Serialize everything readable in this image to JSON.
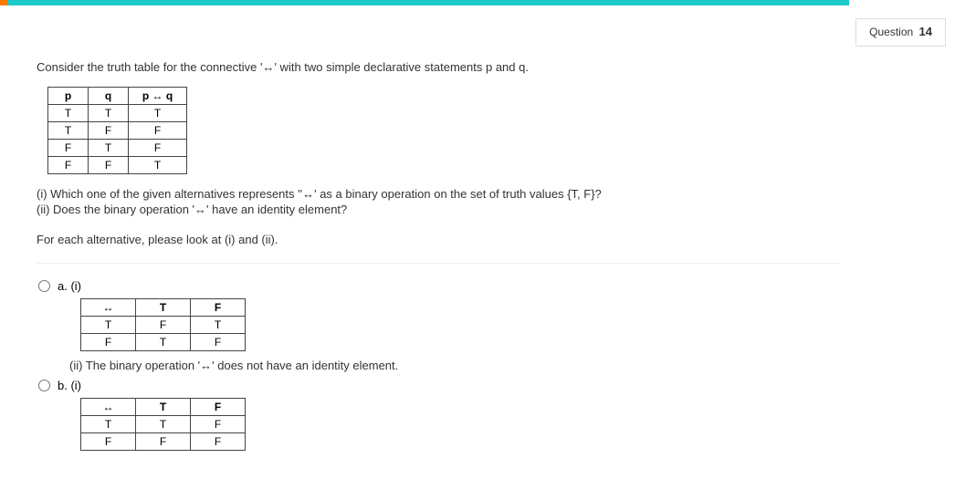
{
  "questionBadge": {
    "label": "Question",
    "number": "14"
  },
  "prompt": "Consider the truth table for the connective '↔' with two simple declarative statements p and q.",
  "mainTable": {
    "headers": [
      "p",
      "q",
      "p ↔ q"
    ],
    "rows": [
      [
        "T",
        "T",
        "T"
      ],
      [
        "T",
        "F",
        "F"
      ],
      [
        "F",
        "T",
        "F"
      ],
      [
        "F",
        "F",
        "T"
      ]
    ]
  },
  "subq1": "(i) Which one of the given alternatives represents ''↔' as a binary operation on the set of truth values {T, F}?",
  "subq2": "(ii) Does the binary operation '↔' have an identity element?",
  "note": "For each alternative, please look at (i) and (ii).",
  "options": {
    "a": {
      "label": "a.",
      "part1label": "(i)",
      "table": {
        "headers": [
          "↔",
          "T",
          "F"
        ],
        "rows": [
          [
            "T",
            "F",
            "T"
          ],
          [
            "F",
            "T",
            "F"
          ]
        ]
      },
      "part2text": "(ii) The binary operation '↔' does not have an identity element."
    },
    "b": {
      "label": "b.",
      "part1label": "(i)",
      "table": {
        "headers": [
          "↔",
          "T",
          "F"
        ],
        "rows": [
          [
            "T",
            "T",
            "F"
          ],
          [
            "F",
            "F",
            "F"
          ]
        ]
      }
    }
  }
}
